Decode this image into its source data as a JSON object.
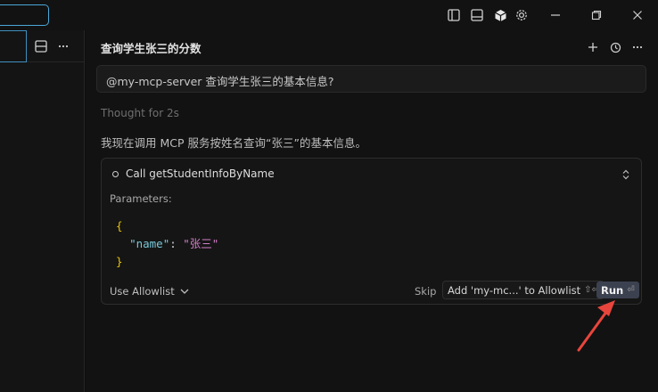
{
  "chat": {
    "title": "查询学生张三的分数",
    "user_message": "@my-mcp-server 查询学生张三的基本信息?",
    "thought": "Thought for 2s",
    "reply": "我现在调用 MCP 服务按姓名查询“张三”的基本信息。"
  },
  "tool_call": {
    "label": "Call getStudentInfoByName",
    "params_label": "Parameters:",
    "code_open": "{",
    "code_key": "\"name\"",
    "code_colon": ": ",
    "code_value": "\"张三\"",
    "code_close": "}",
    "use_allowlist": "Use Allowlist",
    "skip": "Skip",
    "add_allowlist": "Add 'my-mc...' to Allowlist",
    "add_allowlist_shortcut": "⇧⏎",
    "run": "Run",
    "run_shortcut": "⏎"
  },
  "colors": {
    "annotation_arrow": "#e8453c",
    "focus_border": "#4aa8d8"
  }
}
